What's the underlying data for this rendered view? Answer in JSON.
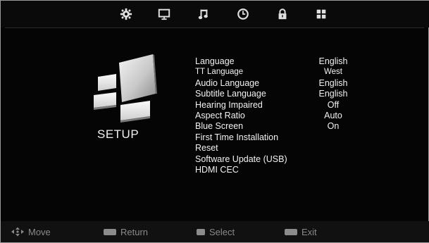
{
  "top_tabs": [
    {
      "icon": "gear-icon",
      "label": ""
    },
    {
      "icon": "monitor-icon",
      "label": ""
    },
    {
      "icon": "music-note-icon",
      "label": ""
    },
    {
      "icon": "clock-icon",
      "label": ""
    },
    {
      "icon": "lock-icon",
      "label": ""
    },
    {
      "icon": "grid-icon",
      "label": ""
    }
  ],
  "section": {
    "title": "SETUP"
  },
  "menu": {
    "items": [
      {
        "label": "Language",
        "value": "English"
      },
      {
        "label": "TT Language",
        "value": "West"
      },
      {
        "label": "Audio Language",
        "value": "English"
      },
      {
        "label": "Subtitle Language",
        "value": "English"
      },
      {
        "label": "Hearing Impaired",
        "value": "Off"
      },
      {
        "label": "Aspect Ratio",
        "value": "Auto"
      },
      {
        "label": "Blue Screen",
        "value": "On"
      },
      {
        "label": "First Time Installation",
        "value": ""
      },
      {
        "label": "Reset",
        "value": ""
      },
      {
        "label": "Software Update (USB)",
        "value": ""
      },
      {
        "label": "HDMI CEC",
        "value": ""
      }
    ]
  },
  "footer": {
    "move_label": "Move",
    "return_label": "Return",
    "select_label": "Select",
    "exit_label": "Exit"
  },
  "colors": {
    "background": "#050505",
    "text": "#f2f2f2",
    "footer_text": "#8a8a8a"
  }
}
